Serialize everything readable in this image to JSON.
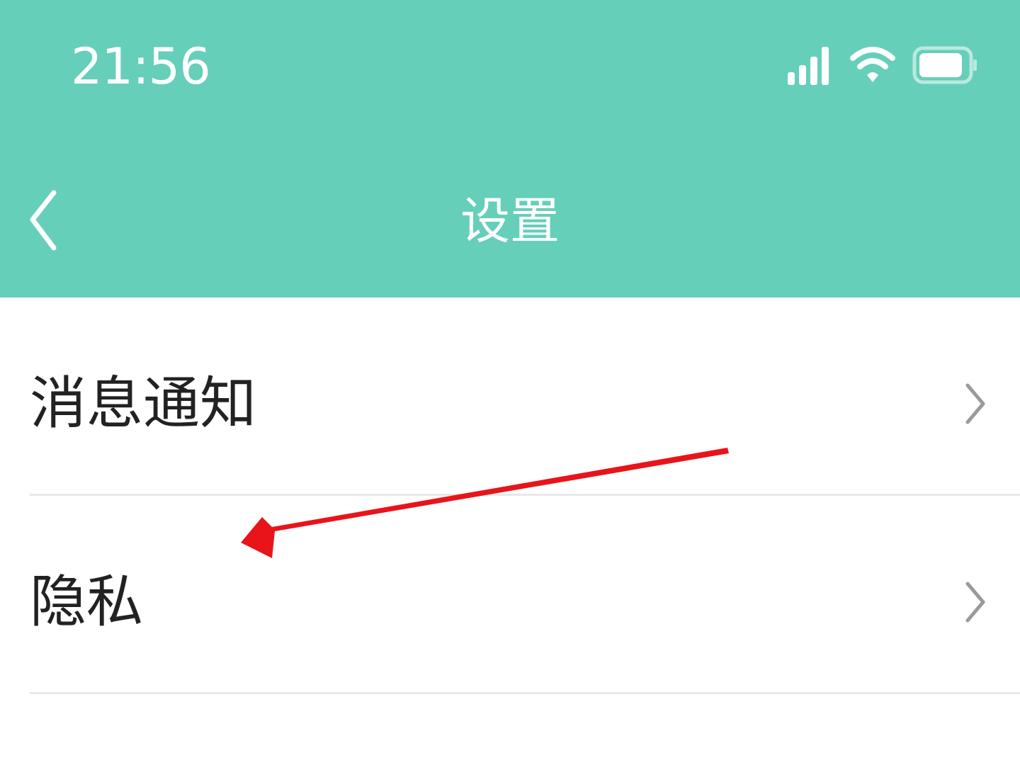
{
  "status_bar": {
    "time": "21:56",
    "icons": [
      "signal-icon",
      "wifi-icon",
      "battery-icon"
    ]
  },
  "nav_bar": {
    "title": "设置",
    "back_icon": "chevron-left-icon"
  },
  "settings_list": {
    "items": [
      {
        "label": "消息通知",
        "icon": "chevron-right-icon"
      },
      {
        "label": "隐私",
        "icon": "chevron-right-icon"
      }
    ]
  },
  "annotation": {
    "arrow_color": "#e8141a",
    "points_to": "隐私"
  },
  "colors": {
    "header_bg": "#66cfb9",
    "text_primary": "#222222",
    "chevron": "#9a9a9a",
    "divider": "#e8e8e8"
  }
}
